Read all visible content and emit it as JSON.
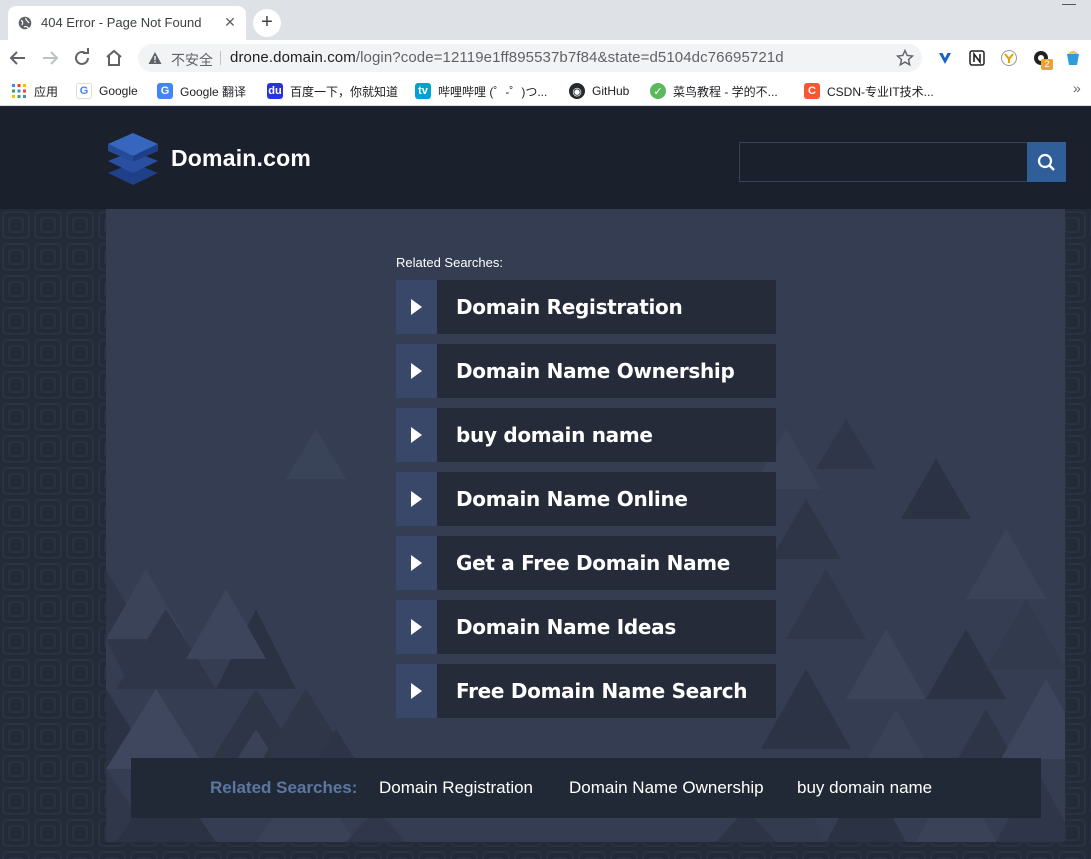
{
  "browser": {
    "tab_title": "404 Error - Page Not Found",
    "tab_close_glyph": "✕",
    "new_tab_glyph": "+",
    "insecure_label": "不安全",
    "url_host": "drone.domain.com",
    "url_path": "/login?code=12119e1ff895537b7f84&state=d5104dc76695721d",
    "bookmarks": [
      {
        "label": "应用",
        "icon": "apps-grid-icon"
      },
      {
        "label": "Google",
        "icon": "google-icon"
      },
      {
        "label": "Google 翻译",
        "icon": "google-translate-icon"
      },
      {
        "label": "百度一下，你就知道",
        "icon": "baidu-icon"
      },
      {
        "label": "哔哩哔哩 (゜-゜)つ...",
        "icon": "bilibili-icon"
      },
      {
        "label": "GitHub",
        "icon": "github-icon"
      },
      {
        "label": "菜鸟教程 - 学的不...",
        "icon": "runoob-icon"
      },
      {
        "label": "CSDN-专业IT技术...",
        "icon": "csdn-icon"
      }
    ],
    "bookmarks_more_glyph": "»",
    "extension_badge": "2"
  },
  "site": {
    "logo_text": "Domain.com",
    "search_placeholder": "",
    "colors": {
      "header_bg": "#1a202c",
      "panel_bg": "#353d52",
      "accent": "#2f5e99",
      "arrow_box": "#394868"
    }
  },
  "related": {
    "label": "Related Searches:",
    "items": [
      "Domain Registration",
      "Domain Name Ownership",
      "buy domain name",
      "Domain Name Online",
      "Get a Free Domain Name",
      "Domain Name Ideas",
      "Free Domain Name Search"
    ]
  },
  "footer": {
    "label": "Related Searches:",
    "links": [
      "Domain Registration",
      "Domain Name Ownership",
      "buy domain name"
    ]
  }
}
